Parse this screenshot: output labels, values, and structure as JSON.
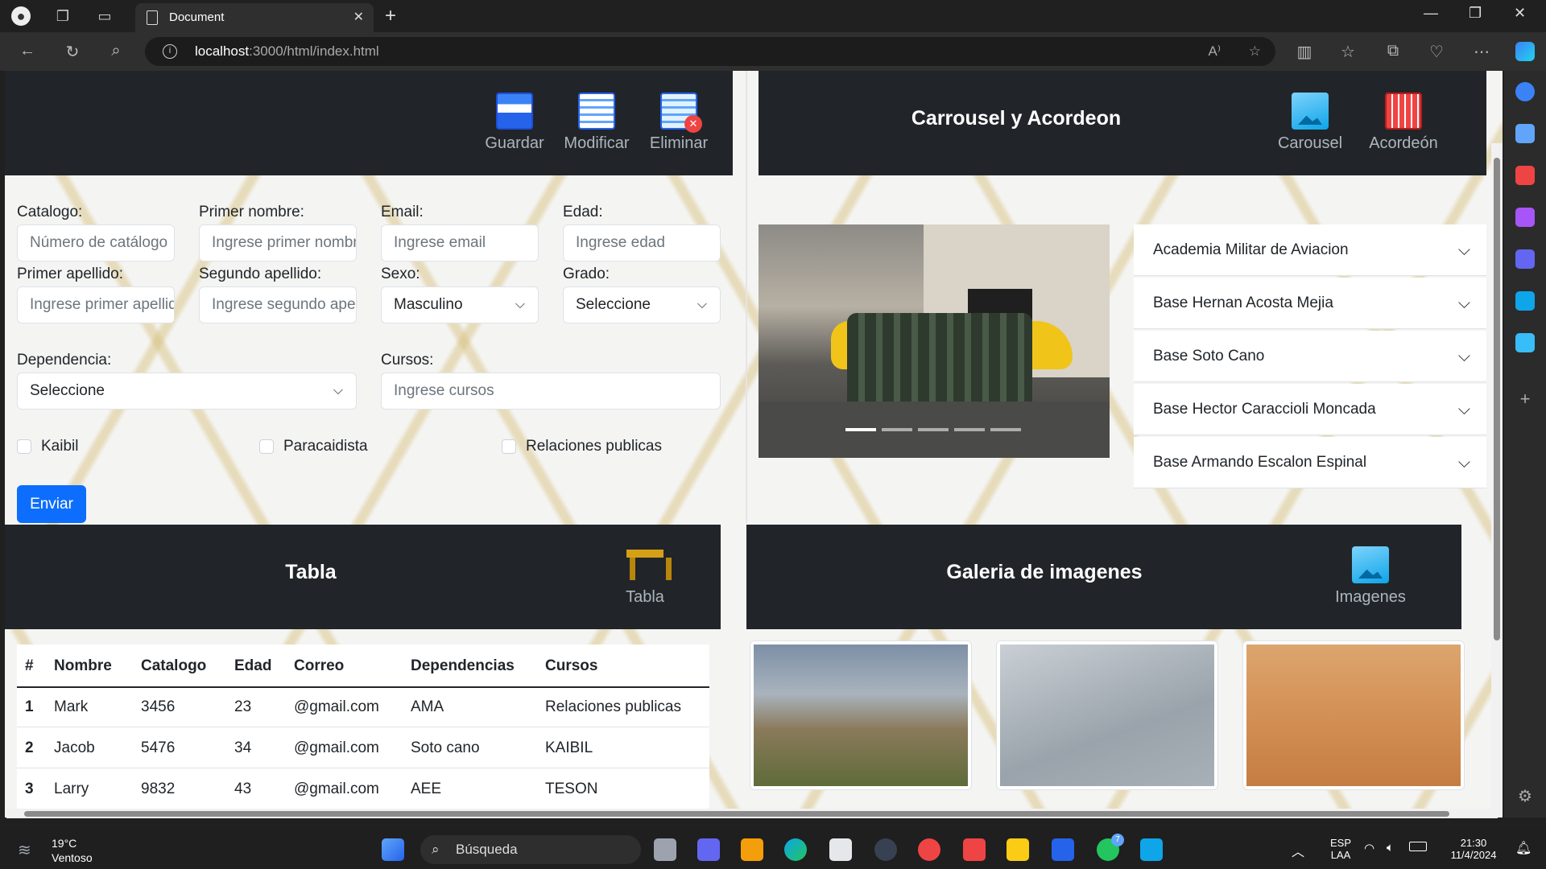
{
  "browser": {
    "tab_title": "Document",
    "url_host": "localhost",
    "url_path": ":3000/html/index.html"
  },
  "form_panel": {
    "buttons": [
      {
        "label": "Guardar",
        "icon": "save-icon"
      },
      {
        "label": "Modificar",
        "icon": "edit-icon"
      },
      {
        "label": "Eliminar",
        "icon": "delete-icon"
      }
    ],
    "fields": {
      "catalogo": {
        "label": "Catalogo:",
        "placeholder": "Número de catálogo"
      },
      "primer_nombre": {
        "label": "Primer nombre:",
        "placeholder": "Ingrese primer nombre"
      },
      "email": {
        "label": "Email:",
        "placeholder": "Ingrese email"
      },
      "edad": {
        "label": "Edad:",
        "placeholder": "Ingrese edad"
      },
      "primer_apellido": {
        "label": "Primer apellido:",
        "placeholder": "Ingrese primer apellido"
      },
      "segundo_apellido": {
        "label": "Segundo apellido:",
        "placeholder": "Ingrese segundo apellido"
      },
      "sexo": {
        "label": "Sexo:",
        "value": "Masculino"
      },
      "grado": {
        "label": "Grado:",
        "value": "Seleccione"
      },
      "dependencia": {
        "label": "Dependencia:",
        "value": "Seleccione"
      },
      "cursos": {
        "label": "Cursos:",
        "placeholder": "Ingrese cursos"
      }
    },
    "checkboxes": [
      "Kaibil",
      "Paracaidista",
      "Relaciones publicas"
    ],
    "submit_label": "Enviar"
  },
  "carousel_panel": {
    "title": "Carrousel y Acordeon",
    "buttons": [
      {
        "label": "Carousel",
        "icon": "image-icon"
      },
      {
        "label": "Acordeón",
        "icon": "accordion-icon"
      }
    ],
    "slide_count": 5,
    "active_slide": 1,
    "accordion": [
      "Academia Militar de Aviacion",
      "Base Hernan Acosta Mejia",
      "Base Soto Cano",
      "Base Hector Caraccioli Moncada",
      "Base Armando Escalon Espinal"
    ]
  },
  "table_panel": {
    "title": "Tabla",
    "button": {
      "label": "Tabla",
      "icon": "table-icon"
    },
    "headers": [
      "#",
      "Nombre",
      "Catalogo",
      "Edad",
      "Correo",
      "Dependencias",
      "Cursos"
    ],
    "rows": [
      [
        "1",
        "Mark",
        "3456",
        "23",
        "@gmail.com",
        "AMA",
        "Relaciones publicas"
      ],
      [
        "2",
        "Jacob",
        "5476",
        "34",
        "@gmail.com",
        "Soto cano",
        "KAIBIL"
      ],
      [
        "3",
        "Larry",
        "9832",
        "43",
        "@gmail.com",
        "AEE",
        "TESON"
      ]
    ]
  },
  "gallery_panel": {
    "title": "Galeria de imagenes",
    "button": {
      "label": "Imagenes",
      "icon": "image-icon"
    }
  },
  "taskbar": {
    "weather_temp": "19°C",
    "weather_desc": "Ventoso",
    "search_label": "Búsqueda",
    "lang_1": "ESP",
    "lang_2": "LAA",
    "time": "21:30",
    "date": "11/4/2024",
    "whatsapp_badge": "7"
  }
}
